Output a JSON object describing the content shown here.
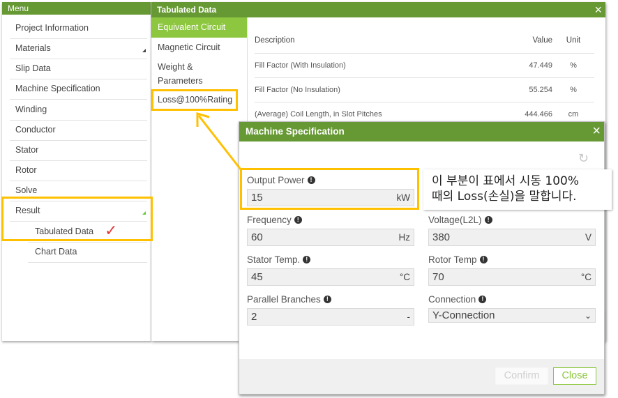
{
  "menu": {
    "title": "Menu",
    "items": [
      {
        "label": "Project Information"
      },
      {
        "label": "Materials"
      },
      {
        "label": "Slip Data"
      },
      {
        "label": "Machine Specification"
      },
      {
        "label": "Winding"
      },
      {
        "label": "Conductor"
      },
      {
        "label": "Stator"
      },
      {
        "label": "Rotor"
      },
      {
        "label": "Solve"
      },
      {
        "label": "Result"
      }
    ],
    "sub_items": [
      {
        "label": "Tabulated Data"
      },
      {
        "label": "Chart Data"
      }
    ]
  },
  "tabulated": {
    "title": "Tabulated Data",
    "close_icon": "×",
    "tabs": [
      {
        "label": "Equivalent Circuit",
        "active": true
      },
      {
        "label": "Magnetic Circuit"
      },
      {
        "label": "Weight &"
      },
      {
        "label": "Parameters"
      },
      {
        "label": "Loss@100%Rating"
      }
    ],
    "table": {
      "headers": {
        "description": "Description",
        "value": "Value",
        "unit": "Unit"
      },
      "rows": [
        {
          "description": "Fill Factor (With Insulation)",
          "value": "47.449",
          "unit": "%"
        },
        {
          "description": "Fill Factor (No Insulation)",
          "value": "55.254",
          "unit": "%"
        },
        {
          "description": "(Average) Coil Length, in Slot Pitches",
          "value": "444.466",
          "unit": "cm"
        }
      ]
    }
  },
  "spec": {
    "title": "Machine Specification",
    "close_icon": "×",
    "refresh_icon": "↻",
    "info_icon": "!",
    "fields": {
      "output_power": {
        "label": "Output Power",
        "value": "15",
        "unit": "kW"
      },
      "frequency": {
        "label": "Frequency",
        "value": "60",
        "unit": "Hz"
      },
      "voltage": {
        "label": "Voltage(L2L)",
        "value": "380",
        "unit": "V"
      },
      "stator_temp": {
        "label": "Stator Temp.",
        "value": "45",
        "unit": "°C"
      },
      "rotor_temp": {
        "label": "Rotor Temp",
        "value": "70",
        "unit": "°C"
      },
      "parallel_branches": {
        "label": "Parallel Branches",
        "value": "2",
        "unit": "-"
      },
      "connection": {
        "label": "Connection",
        "value": "Y-Connection",
        "chevron": "⌄"
      }
    },
    "buttons": {
      "confirm": "Confirm",
      "close": "Close"
    }
  },
  "annotation": {
    "callout_line1": "이 부분이 표에서 시동 100%",
    "callout_line2": "때의 Loss(손실)을 말합니다.",
    "check_mark": "✓",
    "highlight_color": "#ffc000"
  },
  "colors": {
    "header_green": "#669933",
    "active_tab_green": "#8dc63f",
    "close_button_green": "#8dc63f"
  }
}
